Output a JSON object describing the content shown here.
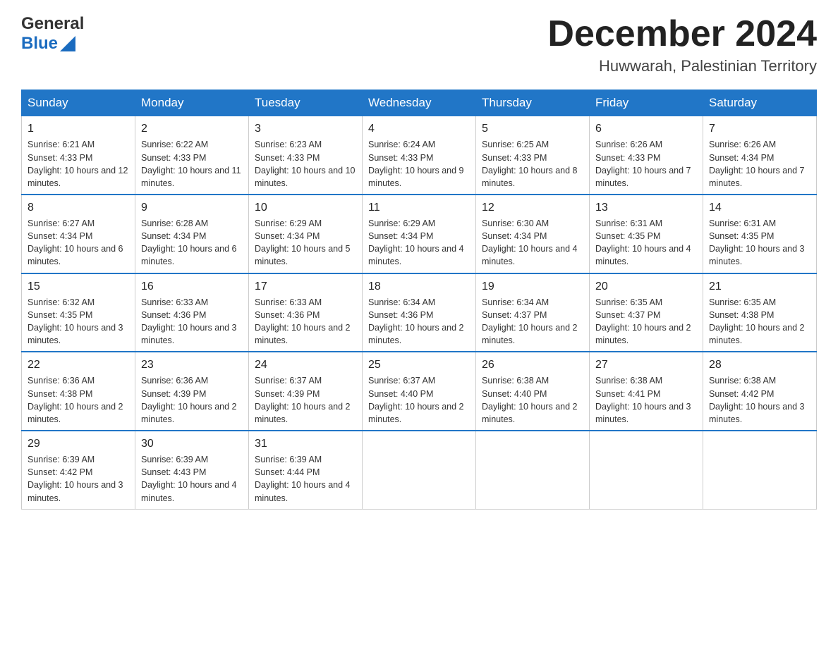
{
  "header": {
    "logo_general": "General",
    "logo_blue": "Blue",
    "title": "December 2024",
    "subtitle": "Huwwarah, Palestinian Territory"
  },
  "weekdays": [
    "Sunday",
    "Monday",
    "Tuesday",
    "Wednesday",
    "Thursday",
    "Friday",
    "Saturday"
  ],
  "weeks": [
    [
      {
        "day": "1",
        "sunrise": "6:21 AM",
        "sunset": "4:33 PM",
        "daylight": "10 hours and 12 minutes."
      },
      {
        "day": "2",
        "sunrise": "6:22 AM",
        "sunset": "4:33 PM",
        "daylight": "10 hours and 11 minutes."
      },
      {
        "day": "3",
        "sunrise": "6:23 AM",
        "sunset": "4:33 PM",
        "daylight": "10 hours and 10 minutes."
      },
      {
        "day": "4",
        "sunrise": "6:24 AM",
        "sunset": "4:33 PM",
        "daylight": "10 hours and 9 minutes."
      },
      {
        "day": "5",
        "sunrise": "6:25 AM",
        "sunset": "4:33 PM",
        "daylight": "10 hours and 8 minutes."
      },
      {
        "day": "6",
        "sunrise": "6:26 AM",
        "sunset": "4:33 PM",
        "daylight": "10 hours and 7 minutes."
      },
      {
        "day": "7",
        "sunrise": "6:26 AM",
        "sunset": "4:34 PM",
        "daylight": "10 hours and 7 minutes."
      }
    ],
    [
      {
        "day": "8",
        "sunrise": "6:27 AM",
        "sunset": "4:34 PM",
        "daylight": "10 hours and 6 minutes."
      },
      {
        "day": "9",
        "sunrise": "6:28 AM",
        "sunset": "4:34 PM",
        "daylight": "10 hours and 6 minutes."
      },
      {
        "day": "10",
        "sunrise": "6:29 AM",
        "sunset": "4:34 PM",
        "daylight": "10 hours and 5 minutes."
      },
      {
        "day": "11",
        "sunrise": "6:29 AM",
        "sunset": "4:34 PM",
        "daylight": "10 hours and 4 minutes."
      },
      {
        "day": "12",
        "sunrise": "6:30 AM",
        "sunset": "4:34 PM",
        "daylight": "10 hours and 4 minutes."
      },
      {
        "day": "13",
        "sunrise": "6:31 AM",
        "sunset": "4:35 PM",
        "daylight": "10 hours and 4 minutes."
      },
      {
        "day": "14",
        "sunrise": "6:31 AM",
        "sunset": "4:35 PM",
        "daylight": "10 hours and 3 minutes."
      }
    ],
    [
      {
        "day": "15",
        "sunrise": "6:32 AM",
        "sunset": "4:35 PM",
        "daylight": "10 hours and 3 minutes."
      },
      {
        "day": "16",
        "sunrise": "6:33 AM",
        "sunset": "4:36 PM",
        "daylight": "10 hours and 3 minutes."
      },
      {
        "day": "17",
        "sunrise": "6:33 AM",
        "sunset": "4:36 PM",
        "daylight": "10 hours and 2 minutes."
      },
      {
        "day": "18",
        "sunrise": "6:34 AM",
        "sunset": "4:36 PM",
        "daylight": "10 hours and 2 minutes."
      },
      {
        "day": "19",
        "sunrise": "6:34 AM",
        "sunset": "4:37 PM",
        "daylight": "10 hours and 2 minutes."
      },
      {
        "day": "20",
        "sunrise": "6:35 AM",
        "sunset": "4:37 PM",
        "daylight": "10 hours and 2 minutes."
      },
      {
        "day": "21",
        "sunrise": "6:35 AM",
        "sunset": "4:38 PM",
        "daylight": "10 hours and 2 minutes."
      }
    ],
    [
      {
        "day": "22",
        "sunrise": "6:36 AM",
        "sunset": "4:38 PM",
        "daylight": "10 hours and 2 minutes."
      },
      {
        "day": "23",
        "sunrise": "6:36 AM",
        "sunset": "4:39 PM",
        "daylight": "10 hours and 2 minutes."
      },
      {
        "day": "24",
        "sunrise": "6:37 AM",
        "sunset": "4:39 PM",
        "daylight": "10 hours and 2 minutes."
      },
      {
        "day": "25",
        "sunrise": "6:37 AM",
        "sunset": "4:40 PM",
        "daylight": "10 hours and 2 minutes."
      },
      {
        "day": "26",
        "sunrise": "6:38 AM",
        "sunset": "4:40 PM",
        "daylight": "10 hours and 2 minutes."
      },
      {
        "day": "27",
        "sunrise": "6:38 AM",
        "sunset": "4:41 PM",
        "daylight": "10 hours and 3 minutes."
      },
      {
        "day": "28",
        "sunrise": "6:38 AM",
        "sunset": "4:42 PM",
        "daylight": "10 hours and 3 minutes."
      }
    ],
    [
      {
        "day": "29",
        "sunrise": "6:39 AM",
        "sunset": "4:42 PM",
        "daylight": "10 hours and 3 minutes."
      },
      {
        "day": "30",
        "sunrise": "6:39 AM",
        "sunset": "4:43 PM",
        "daylight": "10 hours and 4 minutes."
      },
      {
        "day": "31",
        "sunrise": "6:39 AM",
        "sunset": "4:44 PM",
        "daylight": "10 hours and 4 minutes."
      },
      null,
      null,
      null,
      null
    ]
  ],
  "labels": {
    "sunrise_prefix": "Sunrise: ",
    "sunset_prefix": "Sunset: ",
    "daylight_prefix": "Daylight: "
  }
}
